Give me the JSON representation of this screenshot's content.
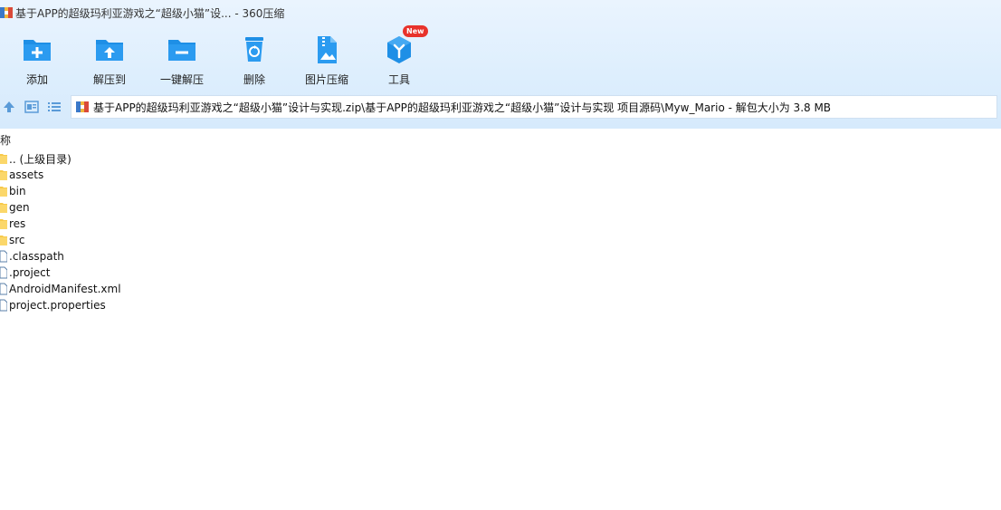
{
  "window": {
    "title": "基于APP的超级玛利亚游戏之“超级小猫”设... - 360压缩"
  },
  "toolbar": {
    "buttons": [
      {
        "label": "添加",
        "icon": "add-folder-icon"
      },
      {
        "label": "解压到",
        "icon": "extract-to-icon"
      },
      {
        "label": "一键解压",
        "icon": "one-click-extract-icon"
      },
      {
        "label": "删除",
        "icon": "recycle-bin-icon"
      },
      {
        "label": "图片压缩",
        "icon": "image-compress-icon"
      },
      {
        "label": "工具",
        "icon": "tools-cube-icon"
      }
    ],
    "new_badge": "New"
  },
  "nav": {
    "up_icon": "arrow-up-icon",
    "view_icon": "view-mode-icon",
    "list_icon": "list-view-icon",
    "path": "基于APP的超级玛利亚游戏之“超级小猫”设计与实现.zip\\基于APP的超级玛利亚游戏之“超级小猫”设计与实现 项目源码\\Myw_Mario - 解包大小为 3.8 MB"
  },
  "columns": {
    "name": "称"
  },
  "files": [
    {
      "name": ".. (上级目录)",
      "kind": "folder"
    },
    {
      "name": "assets",
      "kind": "folder"
    },
    {
      "name": "bin",
      "kind": "folder"
    },
    {
      "name": "gen",
      "kind": "folder"
    },
    {
      "name": "res",
      "kind": "folder"
    },
    {
      "name": "src",
      "kind": "folder"
    },
    {
      "name": ".classpath",
      "kind": "file"
    },
    {
      "name": ".project",
      "kind": "file"
    },
    {
      "name": "AndroidManifest.xml",
      "kind": "file"
    },
    {
      "name": "project.properties",
      "kind": "file"
    }
  ],
  "colors": {
    "accent": "#1e8fe6",
    "folder": "#f7c94a",
    "badge": "#e8322b"
  }
}
